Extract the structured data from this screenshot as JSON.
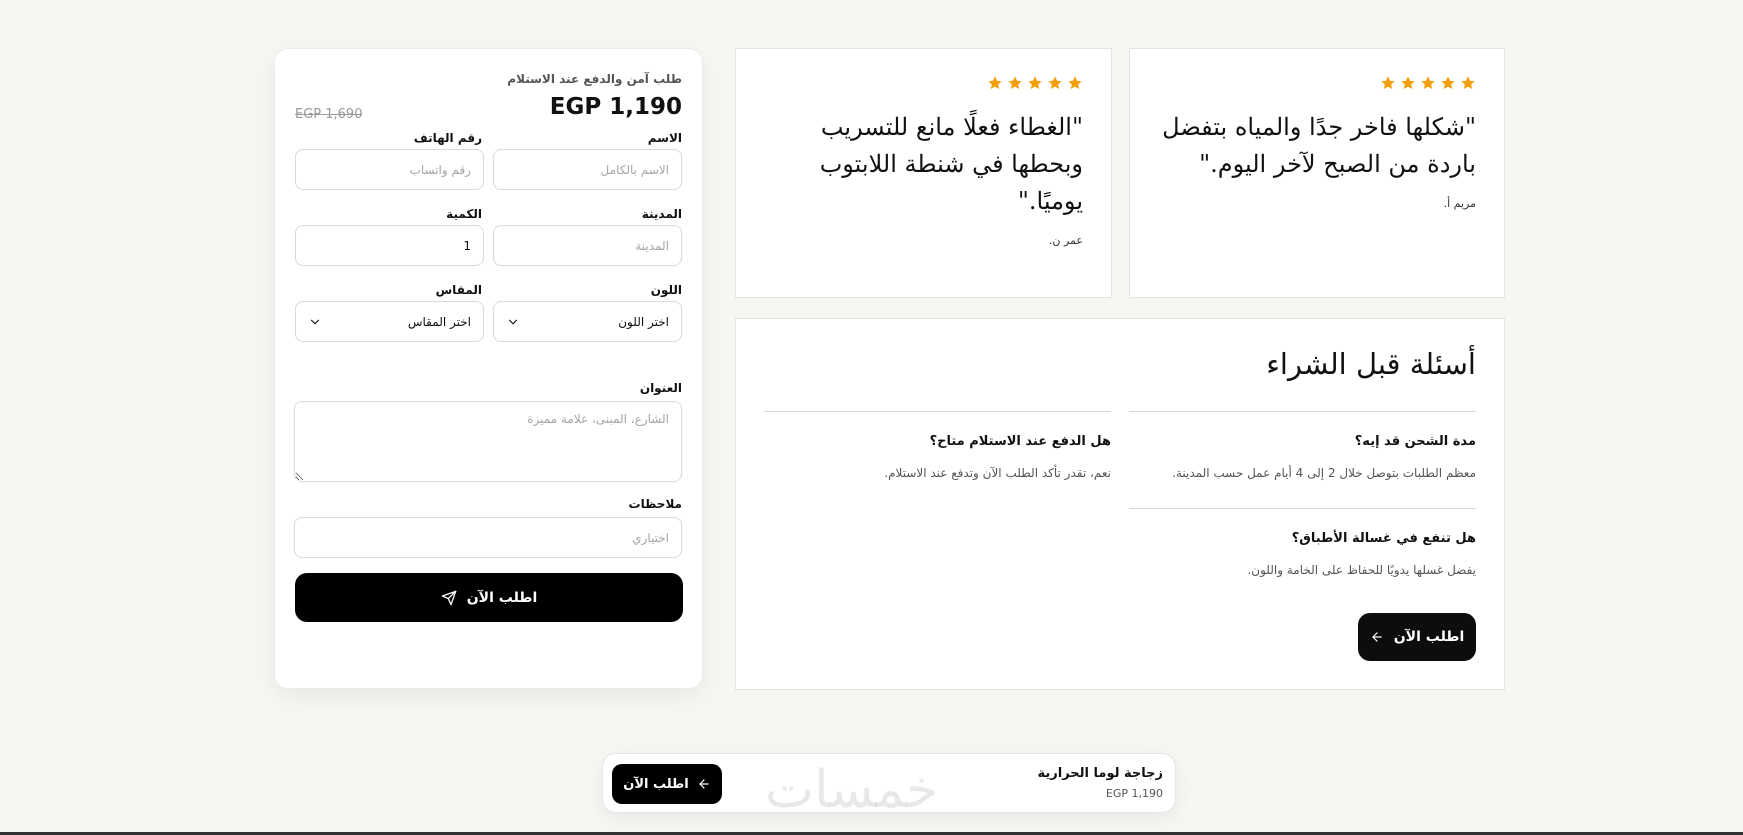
{
  "order_form": {
    "subtitle": "طلب آمن والدفع عند الاستلام",
    "price": "EGP 1,190",
    "old_price": "EGP 1,690",
    "name_label": "الاسم",
    "name_placeholder": "الاسم بالكامل",
    "phone_label": "رقم الهاتف",
    "phone_placeholder": "رقم واتساب",
    "city_label": "المدينة",
    "city_placeholder": "المدينة",
    "quantity_label": "الكمية",
    "quantity_value": "1",
    "color_label": "اللون",
    "color_value": "اختر اللون",
    "size_label": "المقاس",
    "size_value": "اختر المقاس",
    "address_label": "العنوان",
    "address_placeholder": "الشارع، المبنى، علامة مميزة",
    "notes_label": "ملاحظات",
    "notes_placeholder": "اختياري",
    "submit_label": "اطلب الآن"
  },
  "reviews": [
    {
      "quote": "\"شكلها فاخر جدًا والمياه بتفضل باردة من الصبح لآخر اليوم.\"",
      "author": "مريم أ.",
      "rating": 5
    },
    {
      "quote": "\"الغطاء فعلًا مانع للتسريب وبحطها في شنطة اللابتوب يوميًا.\"",
      "author": "عمر ن.",
      "rating": 5
    }
  ],
  "faq": {
    "title": "أسئلة قبل الشراء",
    "items": [
      {
        "q": "مدة الشحن قد إيه؟",
        "a": "معظم الطلبات بتوصل خلال 2 إلى 4 أيام عمل حسب المدينة."
      },
      {
        "q": "هل الدفع عند الاستلام متاح؟",
        "a": "نعم، تقدر تأكد الطلب الآن وتدفع عند الاستلام."
      },
      {
        "q": "هل تنفع في غسالة الأطباق؟",
        "a": "يفضل غسلها يدويًا للحفاظ على الخامة واللون."
      }
    ],
    "button_label": "اطلب الآن"
  },
  "sticky_bar": {
    "product_name": "زجاجة لوما الحرارية",
    "price": "EGP 1,190",
    "button_label": "اطلب الآن"
  },
  "watermark": "خمسات",
  "colors": {
    "background": "#f7f6f3",
    "star": "#f59e0b",
    "button": "#000000"
  },
  "icons": [
    "star-icon",
    "send-icon",
    "arrow-left-icon",
    "chevron-down-icon"
  ]
}
